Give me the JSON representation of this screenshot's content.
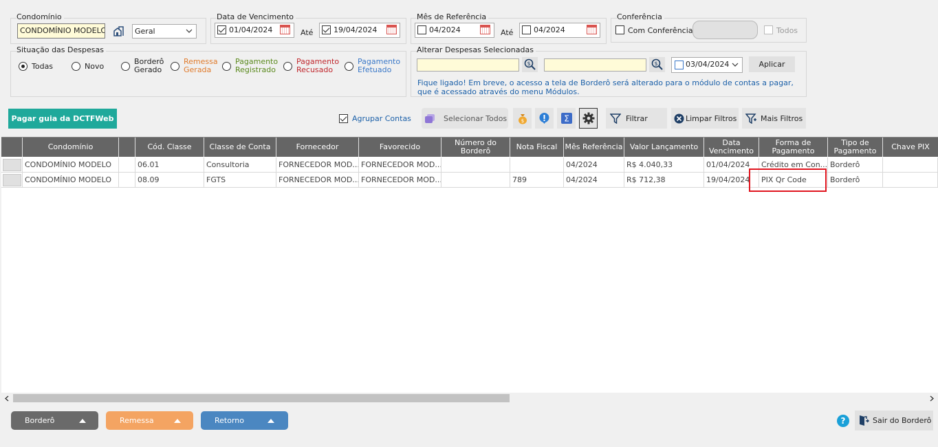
{
  "filters": {
    "condominio": {
      "label": "Condomínio",
      "value": "CONDOMÍNIO MODELO",
      "tipo": "Geral"
    },
    "vencimento": {
      "label": "Data de Vencimento",
      "from": "01/04/2024",
      "ate": "Até",
      "to": "19/04/2024"
    },
    "referencia": {
      "label": "Mês de Referência",
      "from": "04/2024",
      "ate": "Até",
      "to": "04/2024"
    },
    "conferencia": {
      "label": "Conferência",
      "com": "Com Conferência",
      "todos": "Todos"
    },
    "situacao": {
      "label": "Situação das Despesas",
      "options": [
        {
          "l1": "Todas",
          "l2": "",
          "color": "#222222"
        },
        {
          "l1": "Novo",
          "l2": "",
          "color": "#222222"
        },
        {
          "l1": "Borderô",
          "l2": "Gerado",
          "color": "#222222"
        },
        {
          "l1": "Remessa",
          "l2": "Gerada",
          "color": "#e07b2c"
        },
        {
          "l1": "Pagamento",
          "l2": "Registrado",
          "color": "#5b8a1e"
        },
        {
          "l1": "Pagamento",
          "l2": "Recusado",
          "color": "#c0272d"
        },
        {
          "l1": "Pagamento",
          "l2": "Efetuado",
          "color": "#3a78c8"
        }
      ]
    },
    "alterar": {
      "label": "Alterar Despesas Selecionadas",
      "date": "03/04/2024",
      "aplicar": "Aplicar",
      "notice1": "Fique ligado! Em breve, o acesso a tela de Borderô será alterado para o módulo de contas a pagar,",
      "notice2": "que é acessado através do menu Módulos."
    }
  },
  "toolbar": {
    "dctf": "Pagar guia da DCTFWeb",
    "agrupar": "Agrupar Contas",
    "selecionar": "Selecionar Todos",
    "filtrar": "Filtrar",
    "limpar": "Limpar Filtros",
    "mais": "Mais Filtros"
  },
  "grid": {
    "headers": {
      "condominio": "Condomínio",
      "cod": "Cód. Classe",
      "classe": "Classe de Conta",
      "fornecedor": "Fornecedor",
      "favorecido": "Favorecido",
      "bordero": "Número do Borderô",
      "nf": "Nota Fiscal",
      "mes": "Mês Referência",
      "valor": "Valor Lançamento",
      "venc": "Data Vencimento",
      "forma": "Forma de Pagamento",
      "tipo": "Tipo de Pagamento",
      "pix": "Chave PIX"
    },
    "rows": [
      {
        "condominio": "CONDOMÍNIO MODELO",
        "cod": "06.01",
        "classe": "Consultoria",
        "fornecedor": "FORNECEDOR MOD...",
        "favorecido": "FORNECEDOR MOD...",
        "bordero": "",
        "nf": "",
        "mes": "04/2024",
        "valor": "R$ 4.040,33",
        "venc": "01/04/2024",
        "forma": "Crédito em Con...",
        "tipo": "Borderô",
        "pix": ""
      },
      {
        "condominio": "CONDOMÍNIO MODELO",
        "cod": "08.09",
        "classe": "FGTS",
        "fornecedor": "FORNECEDOR MOD...",
        "favorecido": "FORNECEDOR MOD...",
        "bordero": "",
        "nf": "789",
        "mes": "04/2024",
        "valor": "R$ 712,38",
        "venc": "19/04/2024",
        "forma": "PIX Qr Code",
        "tipo": "Borderô",
        "pix": ""
      }
    ]
  },
  "bottom": {
    "bordero": "Borderô",
    "remessa": "Remessa",
    "retorno": "Retorno",
    "sair": "Sair do Borderô"
  },
  "colors": {
    "dctf": "#1fa99b",
    "bordero": "#6a6a6a",
    "remessa": "#f4a462",
    "retorno": "#4b87c1",
    "highlight": "#e0141e",
    "notice": "#1a5fa8"
  }
}
